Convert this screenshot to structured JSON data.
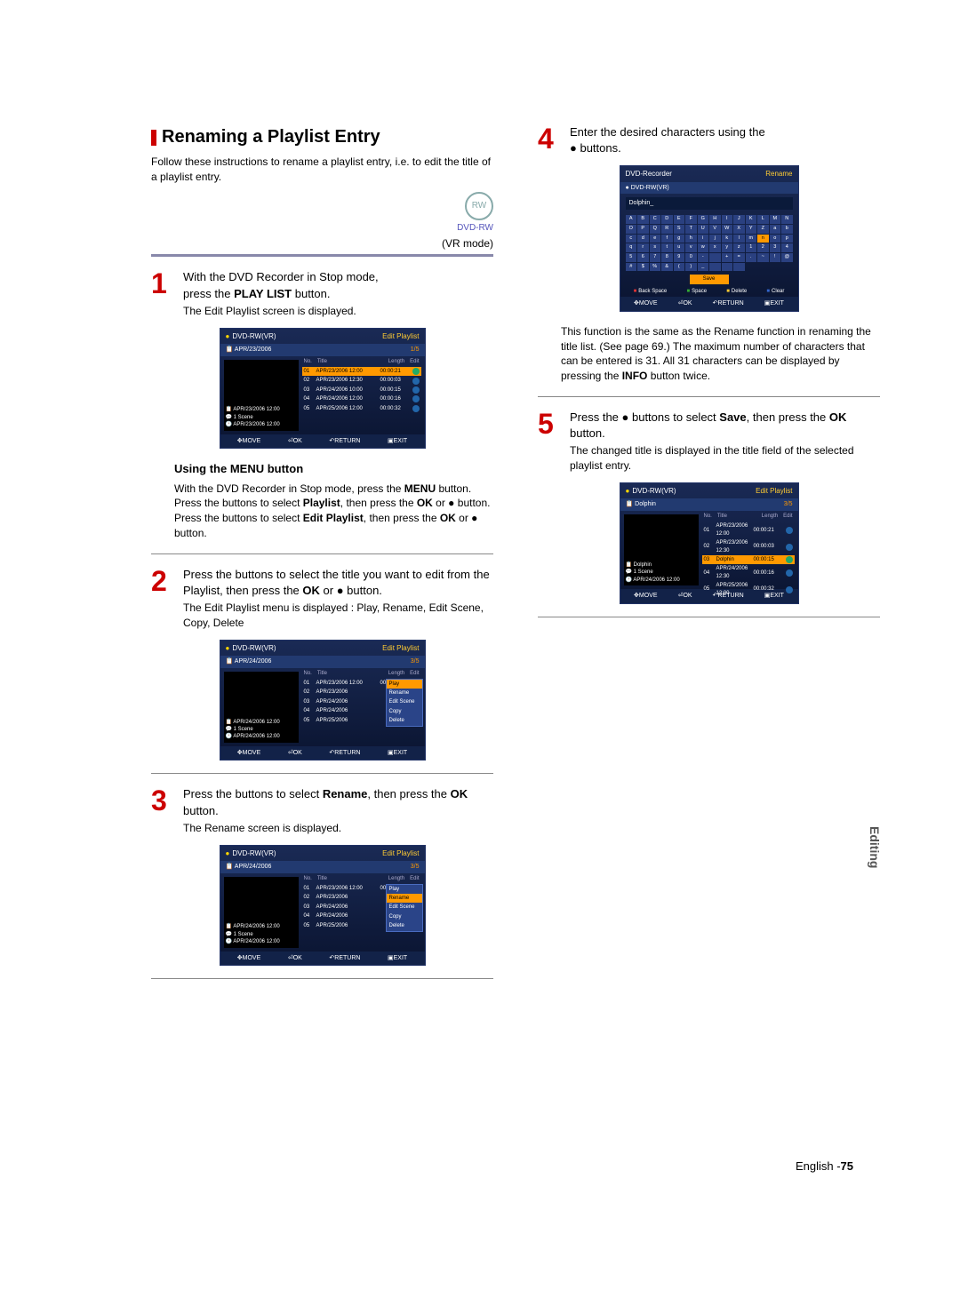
{
  "title": "Renaming a Playlist Entry",
  "intro": "Follow these instructions to rename a playlist entry, i.e. to edit the title of a playlist entry.",
  "disc_label": "DVD-RW",
  "vr_mode": "(VR mode)",
  "step1": {
    "line1a": "With the DVD Recorder in Stop mode,",
    "line1b_pre": "press the ",
    "line1b_btn": "PLAY LIST",
    "line1b_post": " button.",
    "sub": "The Edit Playlist screen is displayed."
  },
  "osd_common": {
    "disc": "DVD-RW(VR)",
    "screen_title": "Edit Playlist",
    "cols": {
      "no": "No.",
      "title": "Title",
      "length": "Length",
      "edit": "Edit"
    },
    "foot": {
      "move": "MOVE",
      "ok": "OK",
      "return": "RETURN",
      "exit": "EXIT"
    },
    "scene_label": "1 Scene"
  },
  "osd1": {
    "hdr_left": "APR/23/2006",
    "count": "1/5",
    "preview_title": "APR/23/2006 12:00",
    "preview_time": "APR/23/2006 12:00",
    "rows": [
      {
        "n": "01",
        "t": "APR/23/2006",
        "tm": "12:00",
        "l": "00:00:21",
        "sel": true
      },
      {
        "n": "02",
        "t": "APR/23/2006",
        "tm": "12:30",
        "l": "00:00:03"
      },
      {
        "n": "03",
        "t": "APR/24/2006",
        "tm": "10:00",
        "l": "00:00:15"
      },
      {
        "n": "04",
        "t": "APR/24/2006",
        "tm": "12:00",
        "l": "00:00:16"
      },
      {
        "n": "05",
        "t": "APR/25/2006",
        "tm": "12:00",
        "l": "00:00:32"
      }
    ]
  },
  "menu_section": {
    "heading": "Using the MENU button",
    "l1_pre": "With the DVD Recorder in Stop mode, press the ",
    "l1_btn": "MENU",
    "l1_post": " button.",
    "l2_pre": "Press the        buttons to select ",
    "l2_btn": "Playlist",
    "l2_post": ", then press the ",
    "l2_btn2": "OK",
    "l2_post2": " or ● button.",
    "l3_pre": "Press the        buttons to select ",
    "l3_btn": "Edit Playlist",
    "l3_post": ", then press the ",
    "l3_btn2": "OK",
    "l3_post2": " or ● button."
  },
  "step2": {
    "l1": "Press the        buttons to select the title you want to edit from the Playlist, then press the ",
    "btn": "OK",
    "post": " or ● button.",
    "sub": "The Edit Playlist menu is displayed : Play, Rename, Edit Scene, Copy, Delete"
  },
  "osd2": {
    "hdr_left": "APR/24/2006",
    "count": "3/5",
    "preview_title": "APR/24/2006 12:00",
    "preview_time": "APR/24/2006 12:00",
    "rows": [
      {
        "n": "01",
        "t": "APR/23/2006",
        "tm": "12:00",
        "l": "00:00:21"
      },
      {
        "n": "02",
        "t": "APR/23/2006",
        "tm": "",
        "l": ""
      },
      {
        "n": "03",
        "t": "APR/24/2006",
        "tm": "",
        "l": ""
      },
      {
        "n": "04",
        "t": "APR/24/2006",
        "tm": "",
        "l": ""
      },
      {
        "n": "05",
        "t": "APR/25/2006",
        "tm": "",
        "l": ""
      }
    ],
    "ctx": [
      "Play",
      "Rename",
      "Edit Scene",
      "Copy",
      "Delete"
    ],
    "ctx_sel": 0
  },
  "step3": {
    "l1_pre": "Press the        buttons to select ",
    "l1_btn": "Rename",
    "l1_mid": ", then press the ",
    "l1_btn2": "OK",
    "l1_post": " button.",
    "sub": "The Rename screen is displayed."
  },
  "osd3": {
    "hdr_left": "APR/24/2006",
    "count": "3/5",
    "preview_title": "APR/24/2006 12:00",
    "preview_time": "APR/24/2006 12:00",
    "ctx_sel": 1
  },
  "step4": {
    "l1": "Enter the desired characters using the",
    "l2": "●           buttons."
  },
  "kb": {
    "top_left": "DVD-Recorder",
    "top_right": "Rename",
    "disc": "DVD-RW(VR)",
    "name": "Dolphin",
    "cursor": "_",
    "rows": [
      [
        "A",
        "B",
        "C",
        "D",
        "E",
        "F",
        "G",
        "H",
        "I",
        "J",
        "K",
        "L",
        "M",
        "N",
        "O",
        "P"
      ],
      [
        "Q",
        "R",
        "S",
        "T",
        "U",
        "V",
        "W",
        "X",
        "Y",
        "Z",
        "a",
        "b",
        "c",
        "d",
        "e",
        "f"
      ],
      [
        "g",
        "h",
        "i",
        "j",
        "k",
        "l",
        "m",
        "n",
        "o",
        "p",
        "q",
        "r",
        "s",
        "t",
        "u",
        "v"
      ],
      [
        "w",
        "x",
        "y",
        "z",
        "1",
        "2",
        "3",
        "4",
        "5",
        "6",
        "7",
        "8",
        "9",
        "0",
        "-",
        " "
      ],
      [
        "+",
        "=",
        ".",
        "~",
        "!",
        "@",
        "#",
        "$",
        "%",
        "&",
        "(",
        ")",
        "_",
        " ",
        " ",
        " "
      ]
    ],
    "sel_row": 2,
    "sel_col": 7,
    "save": "Save",
    "legend": {
      "back": "Back Space",
      "space": "Space",
      "delete": "Delete",
      "clear": "Clear"
    }
  },
  "note": "This function is the same as the Rename function in renaming the title list. (See page 69.) The maximum number of characters that can be entered is 31. All 31 characters can be displayed by pressing the INFO button twice.",
  "note_btn": "INFO",
  "step5": {
    "l1_pre": "Press the  ●           buttons to select ",
    "l1_btn": "Save",
    "l1_mid": ", then press the ",
    "l1_btn2": "OK",
    "l1_post": " button.",
    "sub": "The changed title is displayed in the title field of the selected playlist entry."
  },
  "osd5": {
    "hdr_left": "Dolphin",
    "count": "3/5",
    "preview_title": "Dolphin",
    "preview_time": "APR/24/2006 12:00",
    "rows": [
      {
        "n": "01",
        "t": "APR/23/2006",
        "tm": "12:00",
        "l": "00:00:21"
      },
      {
        "n": "02",
        "t": "APR/23/2006",
        "tm": "12:30",
        "l": "00:00:03"
      },
      {
        "n": "03",
        "t": "Dolphin",
        "tm": "",
        "l": "00:00:15",
        "sel": true
      },
      {
        "n": "04",
        "t": "APR/24/2006",
        "tm": "12:30",
        "l": "00:00:16"
      },
      {
        "n": "05",
        "t": "APR/25/2006",
        "tm": "12:00",
        "l": "00:00:32"
      }
    ]
  },
  "side_tab": "Editing",
  "page_lang": "English -",
  "page_no": "75"
}
